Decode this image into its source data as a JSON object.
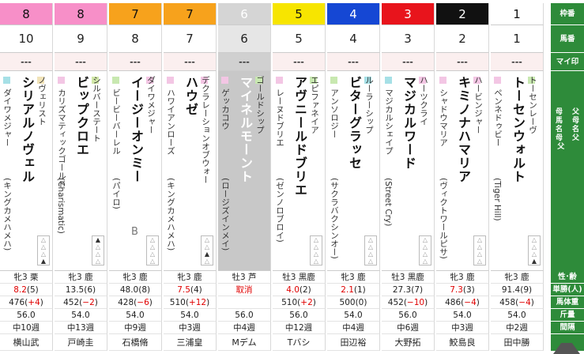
{
  "header_labels": {
    "waku": "枠番",
    "umaban": "馬番",
    "mymark": "マイ印",
    "parentage": [
      "父",
      "母",
      "馬名",
      "母父"
    ],
    "sex_age": "性･齢",
    "odds": "単勝(人)",
    "weight": "馬体重",
    "kinryo": "斤量",
    "interval": "間隔"
  },
  "colors": {
    "frame1": "#ffffff",
    "frame2": "#111111",
    "frame3": "#e8141c",
    "frame4": "#1547d4",
    "frame5": "#f7e500",
    "frame6": "#d5d5d5",
    "frame7": "#f7a21c",
    "frame8": "#f78fc8",
    "header_green": "#2e8b3a",
    "red_text": "#e00000"
  },
  "horses": [
    {
      "waku": "8",
      "umaban": "10",
      "mark": "---",
      "sire": "ダイワメジャー",
      "dam": "",
      "name": "シリアルノヴェル",
      "dam_label": "ノヴェリスト",
      "damsire": "(キングカメハメハ)",
      "sex_age": "牝3 栗",
      "odds": "8.2",
      "pop": "(5)",
      "weight": "476(+4)",
      "kinryo": "56.0",
      "interval": "中10週",
      "jockey": "横山武",
      "sq1": "#a6e0e6",
      "sq2": "#f1e3b8",
      "tri": [
        "△",
        "△",
        "△",
        "▲"
      ],
      "b": ""
    },
    {
      "waku": "8",
      "umaban": "9",
      "mark": "---",
      "sire": "カリズマティックゴールド",
      "dam": "",
      "name": "ビップクロエ",
      "dam_label": "シルバーステート",
      "damsire": "(Charismatic)",
      "sex_age": "牝3 鹿",
      "odds": "13.5",
      "pop": "(6)",
      "weight": "452(−2)",
      "kinryo": "54.0",
      "interval": "中13週",
      "jockey": "戸崎圭",
      "sq1": "#f3c6e4",
      "sq2": "#d2e8a8",
      "tri": [
        "▲",
        "△",
        "△",
        "△"
      ],
      "b": ""
    },
    {
      "waku": "7",
      "umaban": "8",
      "mark": "---",
      "sire": "ビービーバーレル",
      "dam": "",
      "name": "イージーオンミー",
      "dam_label": "ダイワメジャー",
      "damsire": "(パイロ)",
      "sex_age": "牝3 鹿",
      "odds": "48.0",
      "pop": "(8)",
      "weight": "428(−6)",
      "kinryo": "54.0",
      "interval": "中9週",
      "jockey": "石橋脩",
      "sq1": "#c8e8b0",
      "sq2": "#f3c6e4",
      "tri": [
        "△",
        "△",
        "△",
        "△"
      ],
      "b": "B"
    },
    {
      "waku": "7",
      "umaban": "7",
      "mark": "---",
      "sire": "ハワイアンローズ",
      "dam": "",
      "name": "ハウゼ",
      "dam_label": "デクラレーションオブウォー",
      "damsire": "(キングカメハメハ)",
      "sex_age": "牝3 鹿",
      "odds": "7.5",
      "pop": "(4)",
      "weight": "510(+12)",
      "kinryo": "54.0",
      "interval": "中3週",
      "jockey": "三浦皇",
      "sq1": "#f3c6e4",
      "sq2": "#f3c6e4",
      "tri": [
        "△",
        "△",
        "▲",
        "△"
      ],
      "b": ""
    },
    {
      "waku": "6",
      "umaban": "6",
      "mark": "---",
      "sire": "ゲッカコウ",
      "dam": "",
      "name": "マイネルモーント",
      "dam_label": "ゴールドシップ",
      "damsire": "(ロージズインメイ)",
      "sex_age": "牡3 芦",
      "odds": "取消",
      "pop": "",
      "weight": "",
      "kinryo": "56.0",
      "interval": "中4週",
      "jockey": "Mデム",
      "sq1": "#f3c6e4",
      "sq2": "#c8e8b0",
      "tri": [],
      "b": "",
      "scratched": true
    },
    {
      "waku": "5",
      "umaban": "5",
      "mark": "---",
      "sire": "レーヌドブリエ",
      "dam": "",
      "name": "アヴニールドブリエ",
      "dam_label": "エピファネイア",
      "damsire": "(ゼンノロブロイ)",
      "sex_age": "牡3 黒鹿",
      "odds": "4.0",
      "pop": "(2)",
      "weight": "510(+2)",
      "kinryo": "56.0",
      "interval": "中12週",
      "jockey": "Tバシ",
      "sq1": "#f3c6e4",
      "sq2": "#c8e8b0",
      "tri": [
        "△",
        "△",
        "△",
        "△"
      ],
      "b": ""
    },
    {
      "waku": "4",
      "umaban": "4",
      "mark": "---",
      "sire": "アンソロジー",
      "dam": "",
      "name": "ビターグラッセ",
      "dam_label": "ルーラーシップ",
      "damsire": "(サクラバクシンオー)",
      "sex_age": "牝3 鹿",
      "odds": "2.1",
      "pop": "(1)",
      "weight": "500(0)",
      "kinryo": "54.0",
      "interval": "中4週",
      "jockey": "田辺裕",
      "sq1": "#c8e8b0",
      "sq2": "#a6e0e6",
      "tri": [
        "△",
        "△",
        "△",
        "△"
      ],
      "b": ""
    },
    {
      "waku": "3",
      "umaban": "3",
      "mark": "---",
      "sire": "マジカルシェイプ",
      "dam": "",
      "name": "マジカルワード",
      "dam_label": "ハーツクライ",
      "damsire": "(Street Cry)",
      "sex_age": "牡3 黒鹿",
      "odds": "27.3",
      "pop": "(7)",
      "weight": "452(−10)",
      "kinryo": "56.0",
      "interval": "中6週",
      "jockey": "大野拓",
      "sq1": "#a6e0e6",
      "sq2": "#f3c6e4",
      "tri": [
        "△",
        "△",
        "△",
        "△"
      ],
      "b": ""
    },
    {
      "waku": "2",
      "umaban": "2",
      "mark": "---",
      "sire": "シャドウマリア",
      "dam": "",
      "name": "キミノナハマリア",
      "dam_label": "ハービンジャー",
      "damsire": "(ヴィクトワールピサ)",
      "sex_age": "牝3 鹿",
      "odds": "7.3",
      "pop": "(3)",
      "weight": "486(−4)",
      "kinryo": "54.0",
      "interval": "中3週",
      "jockey": "鮫島良",
      "sq1": "#f3c6e4",
      "sq2": "#f3c6e4",
      "tri": [
        "△",
        "△",
        "△",
        "△"
      ],
      "b": ""
    },
    {
      "waku": "1",
      "umaban": "1",
      "mark": "---",
      "sire": "ペンネドゥビー",
      "dam": "",
      "name": "トーセンウォルト",
      "dam_label": "トーセンレーヴ",
      "damsire": "(Tiger Hill)",
      "sex_age": "牝3 鹿",
      "odds": "91.4",
      "pop": "(9)",
      "weight": "458(−4)",
      "kinryo": "54.0",
      "interval": "中2週",
      "jockey": "田中勝",
      "sq1": "#f3c6e4",
      "sq2": "#c8e8b0",
      "tri": [
        "△",
        "△",
        "△",
        "▲"
      ],
      "b": ""
    }
  ]
}
